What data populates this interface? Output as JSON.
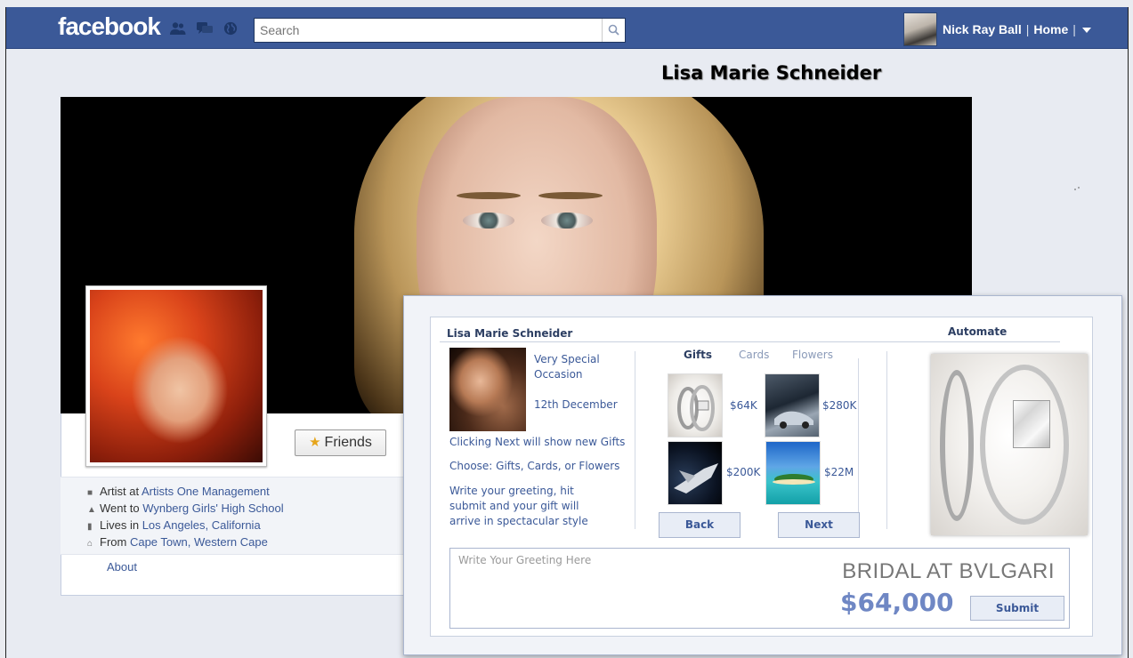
{
  "topbar": {
    "logo": "facebook",
    "search_placeholder": "Search",
    "user_name": "Nick Ray Ball",
    "home_label": "Home",
    "brand_color": "#3b5998",
    "icons": [
      "friend-requests-icon",
      "messages-icon",
      "notifications-globe-icon",
      "search-icon",
      "account-menu-caret-icon"
    ]
  },
  "profile": {
    "name": "Lisa Marie Schneider",
    "friends_button": "Friends",
    "info": [
      {
        "prefix": "Artist at ",
        "link": "Artists One Management",
        "icon": "work-icon"
      },
      {
        "prefix": "Went to ",
        "link": "Wynberg Girls' High School",
        "icon": "education-icon"
      },
      {
        "prefix": "Lives in ",
        "link": "Los Angeles, California",
        "icon": "city-icon"
      },
      {
        "prefix": "From ",
        "link": "Cape Town, Western Cape",
        "icon": "home-icon"
      }
    ],
    "about_link": "About"
  },
  "gift_panel": {
    "recipient": "Lisa Marie Schneider",
    "automate_label": "Automate",
    "occasion_line1": "Very Special",
    "occasion_line2": "Occasion",
    "date": "12th December",
    "hint_next": "Clicking Next will show new Gifts",
    "hint_choose": "Choose: Gifts, Cards, or Flowers",
    "hint_write_1": "Write your greeting, hit",
    "hint_write_2": "submit and your gift will",
    "hint_write_3": "arrive in spectacular style",
    "tabs": [
      "Gifts",
      "Cards",
      "Flowers"
    ],
    "gifts": [
      {
        "price": "$64K",
        "image": "diamond-ring"
      },
      {
        "price": "$280K",
        "image": "sports-car"
      },
      {
        "price": "$200K",
        "image": "spaceship"
      },
      {
        "price": "$22M",
        "image": "tropical-island"
      }
    ],
    "back_label": "Back",
    "next_label": "Next",
    "greeting_placeholder": "Write Your Greeting Here",
    "brand_caption": "BRIDAL AT BVLGARI",
    "price": "$64,000",
    "submit_label": "Submit"
  }
}
